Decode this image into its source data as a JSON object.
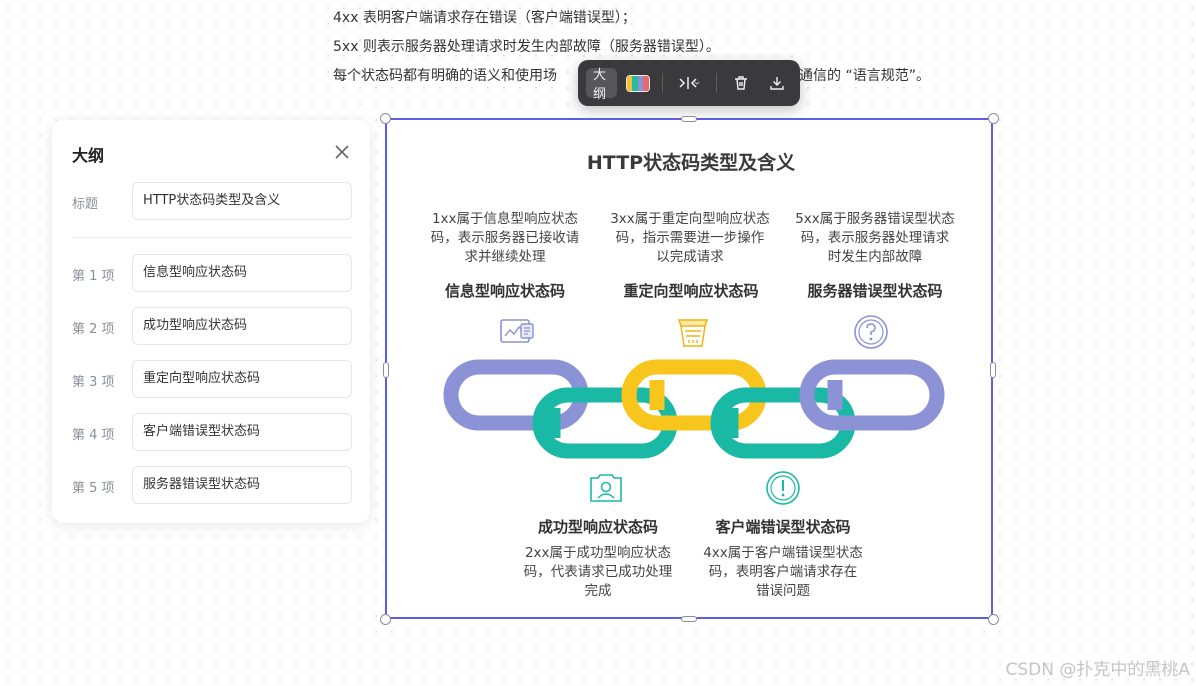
{
  "document": {
    "lines": [
      "4xx 表明客户端请求存在错误（客户端错误型）；",
      "5xx 则表示服务器处理请求时发生内部故障（服务器错误型）。",
      "每个状态码都有明确的语义和使用场",
      "效通信的 “语言规范”。"
    ]
  },
  "toolbar": {
    "outline_label": "大纲",
    "palette_colors": [
      "#f6c12c",
      "#26b9a5",
      "#8b92d6",
      "#e46a6a"
    ],
    "icons": [
      "layout-icon",
      "chevron-down-icon",
      "trash-icon",
      "download-icon"
    ]
  },
  "outline_panel": {
    "title": "大纲",
    "title_field_label": "标题",
    "title_field_value": "HTTP状态码类型及含义",
    "items": [
      {
        "label": "第 1 项",
        "value": "信息型响应状态码"
      },
      {
        "label": "第 2 项",
        "value": "成功型响应状态码"
      },
      {
        "label": "第 3 项",
        "value": "重定向型响应状态码"
      },
      {
        "label": "第 4 项",
        "value": "客户端错误型状态码"
      },
      {
        "label": "第 5 项",
        "value": "服务器错误型状态码"
      }
    ]
  },
  "infographic": {
    "title": "HTTP状态码类型及含义",
    "colors": {
      "purple": "#8b92d6",
      "teal": "#19b9a5",
      "yellow": "#f8c51c",
      "accent": "#5b5ee6"
    },
    "top": [
      {
        "name": "信息型响应状态码",
        "desc": [
          "1xx属于信息型响应状态",
          "码，表示服务器已接收请",
          "求并继续处理"
        ],
        "icon": "dashboard-icon"
      },
      {
        "name": "重定向型响应状态码",
        "desc": [
          "3xx属于重定向型响应状态",
          "码，指示需要进一步操作",
          "以完成请求"
        ],
        "icon": "basket-icon"
      },
      {
        "name": "服务器错误型状态码",
        "desc": [
          "5xx属于服务器错误型状态",
          "码，表示服务器处理请求",
          "时发生内部故障"
        ],
        "icon": "question-icon"
      }
    ],
    "bottom": [
      {
        "name": "成功型响应状态码",
        "desc": [
          "2xx属于成功型响应状态",
          "码，代表请求已成功处理",
          "完成"
        ],
        "icon": "user-card-icon"
      },
      {
        "name": "客户端错误型状态码",
        "desc": [
          "4xx属于客户端错误型状态",
          "码，表明客户端请求存在",
          "错误问题"
        ],
        "icon": "alert-icon"
      }
    ]
  },
  "watermark": "CSDN @扑克中的黑桃A"
}
